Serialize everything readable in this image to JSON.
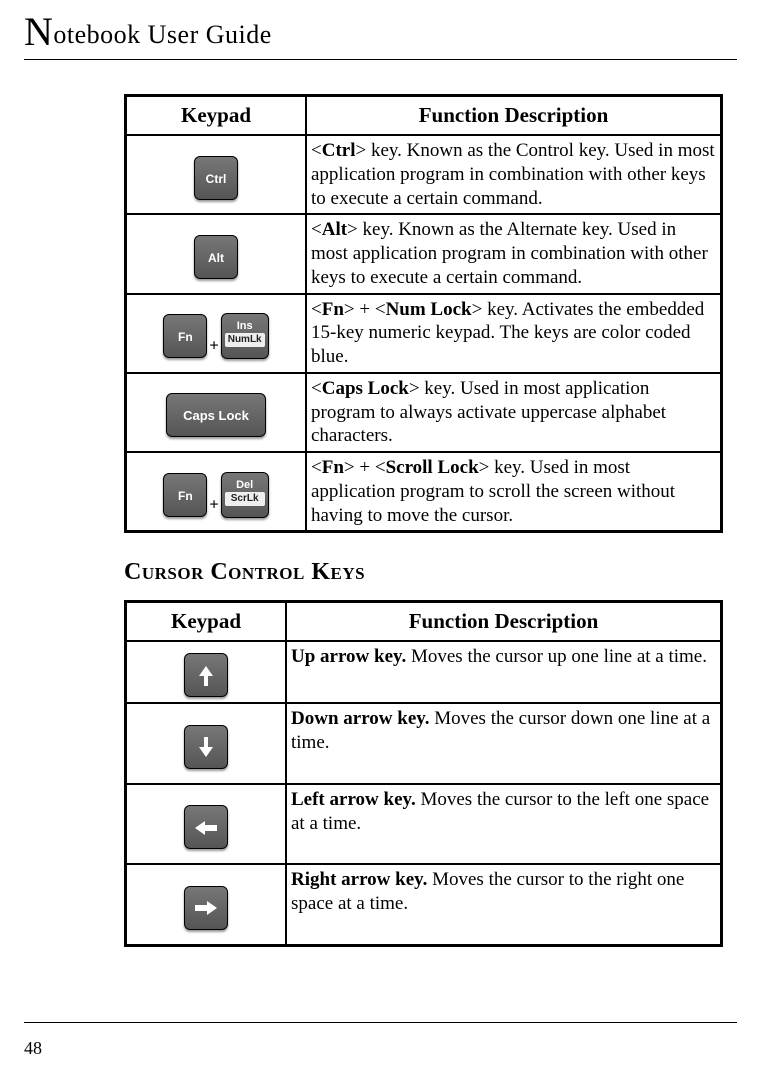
{
  "header": {
    "title_rest": "otebook User Guide",
    "title_initial": "N"
  },
  "table1": {
    "hdr_keypad": "Keypad",
    "hdr_desc": "Function Description",
    "rows": [
      {
        "key1": "Ctrl",
        "bold": "Ctrl",
        "rest": "> key. Known as the Control key. Used in most application program in combination with other keys to execute a certain command."
      },
      {
        "key1": "Alt",
        "bold": "Alt",
        "rest": "> key. Known as the Alternate key. Used in most application program in combination with other keys to execute a certain command."
      },
      {
        "key1": "Fn",
        "key2a": "Ins",
        "key2b": "NumLk",
        "b1": "Fn",
        "mid": "> + <",
        "b2": "Num Lock",
        "rest": "> key. Activates the embedded 15-key numeric keypad. The keys are color coded blue."
      },
      {
        "key1": "Caps Lock",
        "bold": "Caps Lock",
        "rest": "> key. Used in most application program to always activate uppercase alphabet characters."
      },
      {
        "key1": "Fn",
        "key2a": "Del",
        "key2b": "ScrLk",
        "b1": "Fn",
        "mid": "> + <",
        "b2": "Scroll Lock",
        "rest": "> key. Used in most application program to scroll the screen without having to move the cursor."
      }
    ]
  },
  "section2_title": "Cursor Control Keys",
  "table2": {
    "hdr_keypad": "Keypad",
    "hdr_desc": "Function Description",
    "rows": [
      {
        "dir": "up",
        "bold": "Up arrow key.",
        "rest": " Moves the cursor up one line at a time."
      },
      {
        "dir": "down",
        "bold": "Down arrow key.",
        "rest": " Moves the cursor down one line at a time."
      },
      {
        "dir": "left",
        "bold": "Left arrow key.",
        "rest": " Moves the cursor to the left one space at a time."
      },
      {
        "dir": "right",
        "bold": "Right arrow key.",
        "rest": " Moves the cursor to the right one space at a time."
      }
    ]
  },
  "page_number": "48"
}
